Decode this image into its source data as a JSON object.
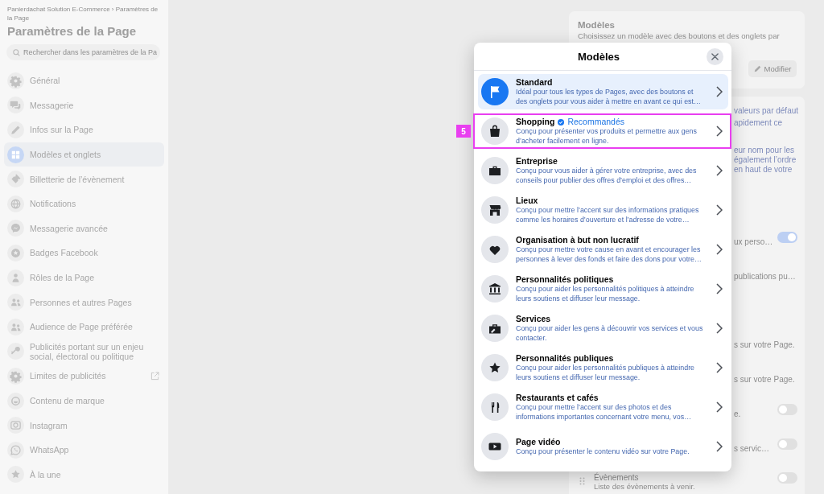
{
  "sidebar": {
    "breadcrumb": "Panierdachat Solution E-Commerce › Paramètres de la Page",
    "title": "Paramètres de la Page",
    "search": {
      "placeholder": "Rechercher dans les paramètres de la Pa"
    },
    "items": [
      {
        "label": "Général",
        "selected": false,
        "external": false
      },
      {
        "label": "Messagerie",
        "selected": false,
        "external": false
      },
      {
        "label": "Infos sur la Page",
        "selected": false,
        "external": false
      },
      {
        "label": "Modèles et onglets",
        "selected": true,
        "external": false
      },
      {
        "label": "Billetterie de l’évènement",
        "selected": false,
        "external": false
      },
      {
        "label": "Notifications",
        "selected": false,
        "external": false
      },
      {
        "label": "Messagerie avancée",
        "selected": false,
        "external": false
      },
      {
        "label": "Badges Facebook",
        "selected": false,
        "external": false
      },
      {
        "label": "Rôles de la Page",
        "selected": false,
        "external": false
      },
      {
        "label": "Personnes et autres Pages",
        "selected": false,
        "external": false
      },
      {
        "label": "Audience de Page préférée",
        "selected": false,
        "external": false
      },
      {
        "label": "Publicités portant sur un enjeu social, électoral ou politique",
        "selected": false,
        "external": false
      },
      {
        "label": "Limites de publicités",
        "selected": false,
        "external": true
      },
      {
        "label": "Contenu de marque",
        "selected": false,
        "external": false
      },
      {
        "label": "Instagram",
        "selected": false,
        "external": false
      },
      {
        "label": "WhatsApp",
        "selected": false,
        "external": false
      },
      {
        "label": "À la une",
        "selected": false,
        "external": false
      }
    ]
  },
  "settings": {
    "templates_card": {
      "title": "Modèles",
      "description": "Choisissez un modèle avec des boutons et des onglets par",
      "button": "Modifier"
    },
    "tabs_card": {
      "paragraphs": [
        [
          "valeurs par défaut",
          "apidement ce"
        ],
        [
          "eur nom pour les",
          "également l’ordre",
          "en haut de votre"
        ]
      ],
      "rows": [
        {
          "kind": "toggle",
          "text": "ux perso…",
          "on": true
        },
        {
          "kind": "text",
          "text": "publications pu…"
        },
        {
          "kind": "text",
          "text": "s sur votre Page."
        },
        {
          "kind": "text",
          "text": "s sur votre Page."
        },
        {
          "kind": "toggle",
          "text": "e.",
          "on": false
        },
        {
          "kind": "toggle",
          "text": "s servic…",
          "on": false
        }
      ],
      "event": {
        "title": "Évènements",
        "description": "Liste des évènements à venir.",
        "on": false
      }
    }
  },
  "modal": {
    "title": "Modèles",
    "templates": [
      {
        "title": "Standard",
        "description": "Idéal pour tous les types de Pages, avec des boutons et des onglets pour vous aider à mettre en avant ce qui est…",
        "selected": true,
        "highlighted": false
      },
      {
        "title": "Shopping",
        "badge": "Recommandés",
        "description": "Conçu pour présenter vos produits et permettre aux gens d’acheter facilement en ligne.",
        "selected": false,
        "highlighted": true
      },
      {
        "title": "Entreprise",
        "description": "Conçu pour vous aider à gérer votre entreprise, avec des conseils pour publier des offres d’emploi et des offres…",
        "selected": false,
        "highlighted": false
      },
      {
        "title": "Lieux",
        "description": "Conçu pour mettre l’accent sur des informations pratiques comme les horaires d’ouverture et l’adresse de votre…",
        "selected": false,
        "highlighted": false
      },
      {
        "title": "Organisation à but non lucratif",
        "description": "Conçu pour mettre votre cause en avant et encourager les personnes à lever des fonds et faire des dons pour votre…",
        "selected": false,
        "highlighted": false
      },
      {
        "title": "Personnalités politiques",
        "description": "Conçu pour aider les personnalités politiques à atteindre leurs soutiens et diffuser leur message.",
        "selected": false,
        "highlighted": false
      },
      {
        "title": "Services",
        "description": "Conçu pour aider les gens à découvrir vos services et vous contacter.",
        "selected": false,
        "highlighted": false
      },
      {
        "title": "Personnalités publiques",
        "description": "Conçu pour aider les personnalités publiques à atteindre leurs soutiens et diffuser leur message.",
        "selected": false,
        "highlighted": false
      },
      {
        "title": "Restaurants et cafés",
        "description": "Conçu pour mettre l’accent sur des photos et des informations importantes concernant votre menu, vos…",
        "selected": false,
        "highlighted": false
      },
      {
        "title": "Page vidéo",
        "description": "Conçu pour présenter le contenu vidéo sur votre Page.",
        "selected": false,
        "highlighted": false
      }
    ]
  },
  "annotation": {
    "label": "5"
  }
}
